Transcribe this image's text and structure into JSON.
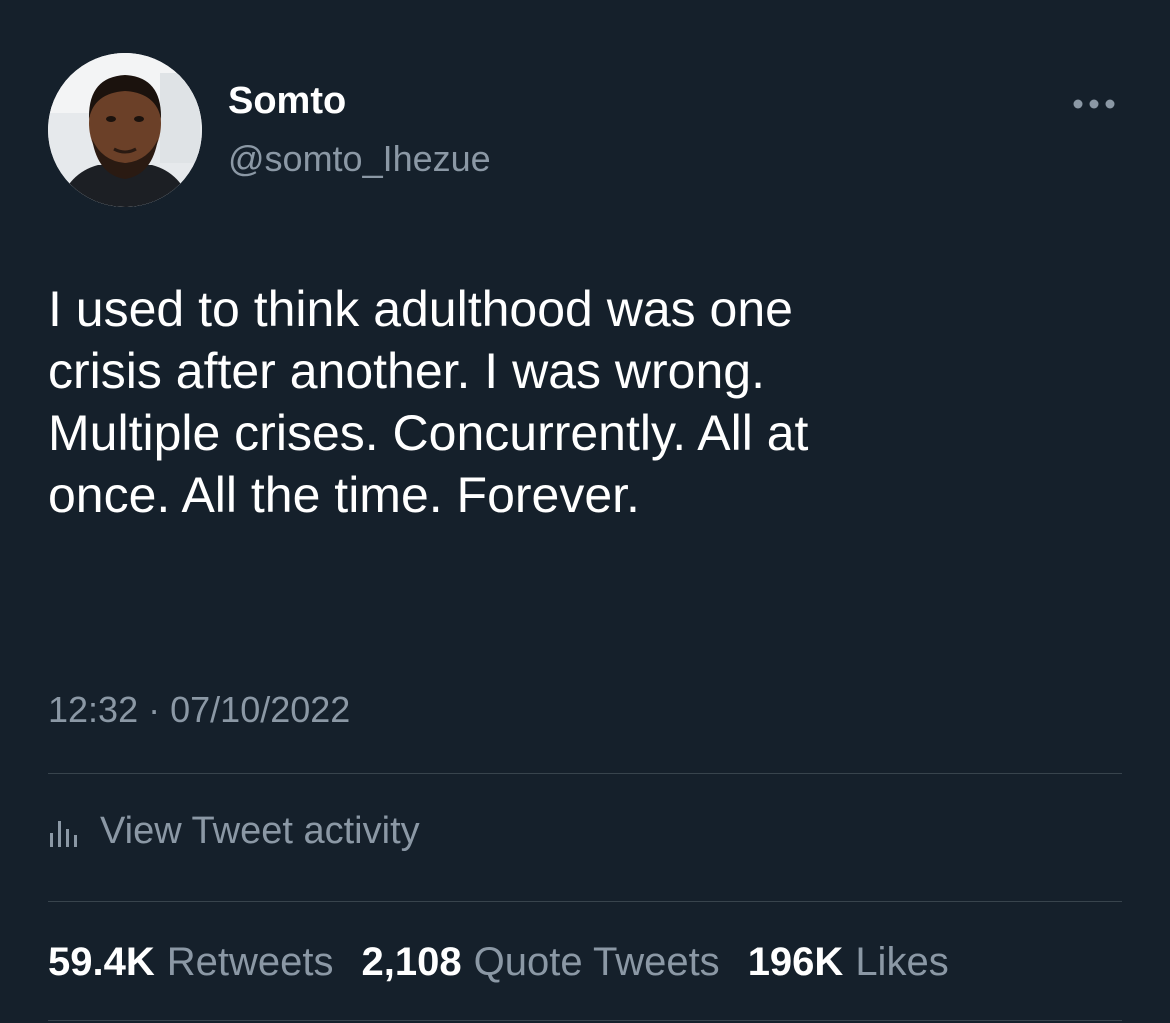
{
  "user": {
    "display_name": "Somto",
    "handle": "@somto_Ihezue",
    "avatar": "profile-photo"
  },
  "tweet": {
    "lines": [
      "I used to think adulthood was one",
      "crisis after another. I was wrong.",
      "Multiple crises. Concurrently. All at",
      "once. All the time. Forever."
    ],
    "time": "12:32",
    "separator": "·",
    "date": "07/10/2022"
  },
  "activity": {
    "label": "View Tweet activity",
    "icon": "bar-chart-icon"
  },
  "stats": {
    "retweets_count": "59.4K",
    "retweets_label": "Retweets",
    "quotes_count": "2,108",
    "quotes_label": "Quote Tweets",
    "likes_count": "196K",
    "likes_label": "Likes"
  },
  "more_icon": "more-horizontal-icon",
  "colors": {
    "background": "#15202b",
    "primary_text": "#ffffff",
    "secondary_text": "#8b98a5",
    "divider": "#38444d"
  }
}
